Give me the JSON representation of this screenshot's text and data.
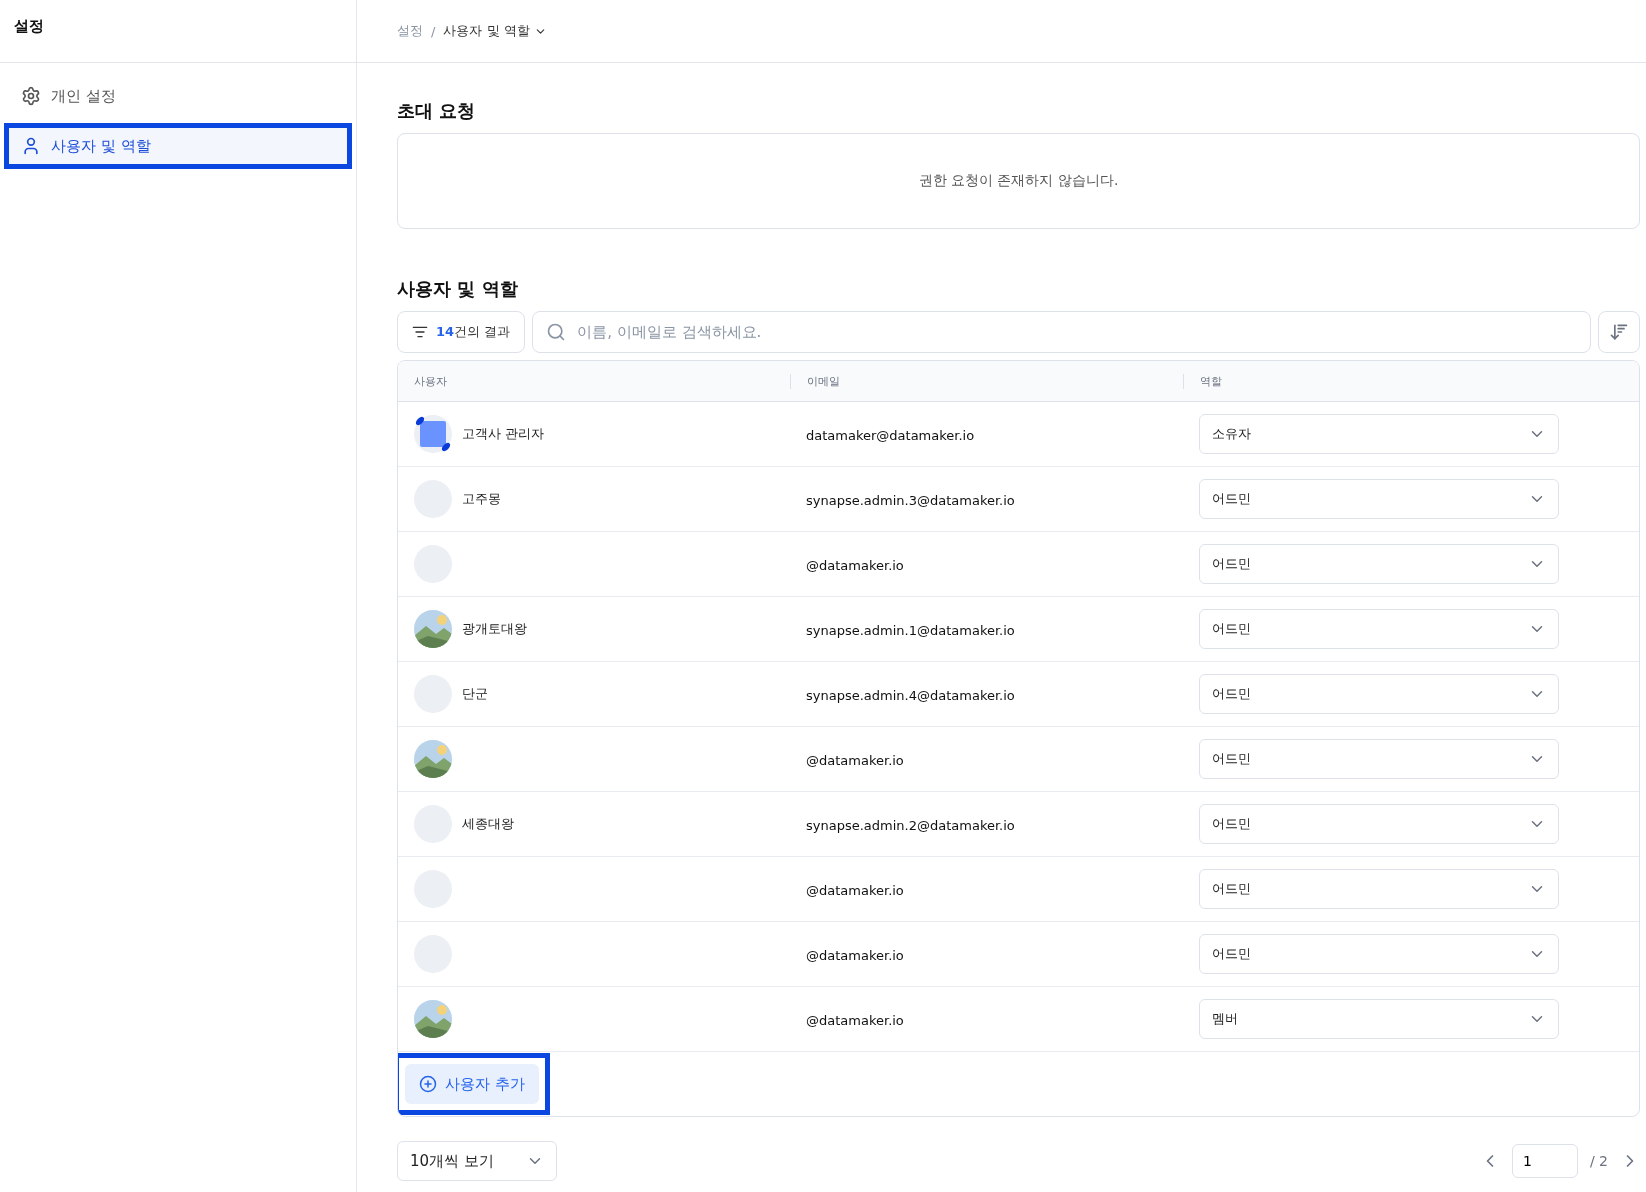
{
  "sidebar": {
    "title": "설정",
    "items": [
      {
        "label": "개인 설정",
        "kind": "settings",
        "selected": false,
        "highlighted": false
      },
      {
        "label": "사용자 및 역할",
        "kind": "user",
        "selected": true,
        "highlighted": true
      }
    ]
  },
  "breadcrumb": [
    {
      "label": "설정"
    },
    {
      "label": "사용자 및 역할",
      "dropdown": true
    }
  ],
  "breadcrumb_separator": "/",
  "invites": {
    "title": "초대 요청",
    "empty_message": "권한 요청이 존재하지 않습니다."
  },
  "users": {
    "title": "사용자 및 역할",
    "result_count": "14",
    "result_suffix": "건의 결과",
    "search": {
      "placeholder": "이름, 이메일로 검색하세요."
    },
    "columns": [
      "사용자",
      "이메일",
      "역할"
    ],
    "rows": [
      {
        "kind": "logo",
        "name": "고객사 관리자",
        "email": "datamaker@datamaker.io",
        "role": "소유자"
      },
      {
        "kind": "blank",
        "name": "고주몽",
        "email": "synapse.admin.3@datamaker.io",
        "role": "어드민"
      },
      {
        "kind": "blank",
        "email": "@datamaker.io",
        "role": "어드민"
      },
      {
        "kind": "picture",
        "name": "광개토대왕",
        "email": "synapse.admin.1@datamaker.io",
        "role": "어드민"
      },
      {
        "kind": "blank",
        "name": "단군",
        "email": "synapse.admin.4@datamaker.io",
        "role": "어드민"
      },
      {
        "kind": "picture",
        "email": "@datamaker.io",
        "role": "어드민"
      },
      {
        "kind": "blank",
        "name": "세종대왕",
        "email": "synapse.admin.2@datamaker.io",
        "role": "어드민"
      },
      {
        "kind": "blank",
        "email": "@datamaker.io",
        "role": "어드민"
      },
      {
        "kind": "blank",
        "email": "@datamaker.io",
        "role": "어드민"
      },
      {
        "kind": "picture",
        "email": "@datamaker.io",
        "role": "멤버"
      }
    ],
    "add_button": {
      "label": "사용자 추가",
      "highlighted": true
    }
  },
  "pagination": {
    "page_size": "10개씩 보기",
    "page": "1",
    "total": "/ 2"
  }
}
